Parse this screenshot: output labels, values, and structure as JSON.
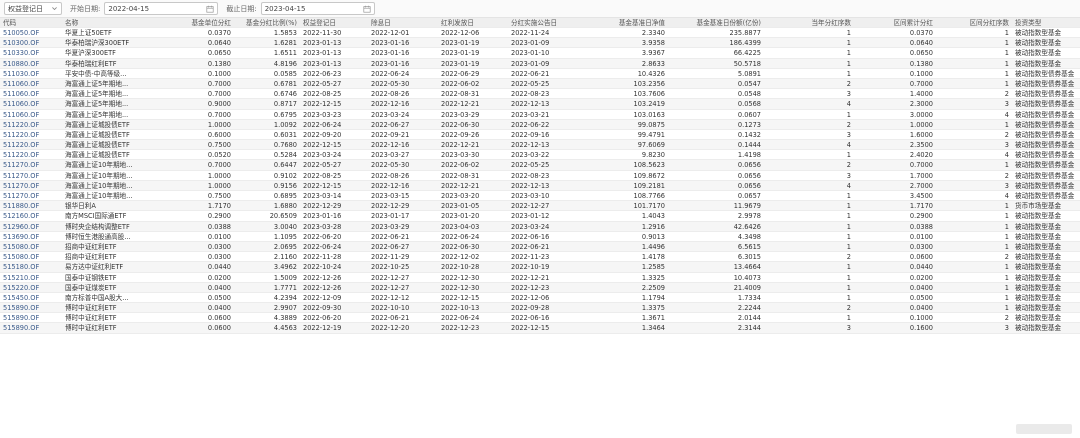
{
  "toolbar": {
    "field_select": "权益登记日",
    "start_label": "开始日期:",
    "start_value": "2022-04-15",
    "end_label": "截止日期:",
    "end_value": "2023-04-15"
  },
  "headers": [
    "代码",
    "名称",
    "基金单位分红",
    "基金分红比例(%)",
    "权益登记日",
    "除息日",
    "红利发放日",
    "分红实施公告日",
    "基金基准日净值",
    "基金基准日份额(亿份)",
    "当年分红序数",
    "区间累计分红",
    "区间分红序数",
    "投资类型"
  ],
  "rows": [
    [
      "510050.OF",
      "华夏上证50ETF",
      "0.0370",
      "1.5853",
      "2022-11-30",
      "2022-12-01",
      "2022-12-06",
      "2022-11-24",
      "2.3340",
      "235.8877",
      "1",
      "0.0370",
      "1",
      "被动指数型基金"
    ],
    [
      "510300.OF",
      "华泰柏瑞沪深300ETF",
      "0.0640",
      "1.6281",
      "2023-01-13",
      "2023-01-16",
      "2023-01-19",
      "2023-01-09",
      "3.9358",
      "186.4399",
      "1",
      "0.0640",
      "1",
      "被动指数型基金"
    ],
    [
      "510330.OF",
      "华夏沪深300ETF",
      "0.0650",
      "1.6511",
      "2023-01-13",
      "2023-01-16",
      "2023-01-19",
      "2023-01-10",
      "3.9367",
      "66.4225",
      "1",
      "0.0650",
      "1",
      "被动指数型基金"
    ],
    [
      "510880.OF",
      "华泰柏瑞红利ETF",
      "0.1380",
      "4.8196",
      "2023-01-13",
      "2023-01-16",
      "2023-01-19",
      "2023-01-09",
      "2.8633",
      "50.5718",
      "1",
      "0.1380",
      "1",
      "被动指数型基金"
    ],
    [
      "511030.OF",
      "平安中债-中高等级...",
      "0.1000",
      "0.0585",
      "2022-06-23",
      "2022-06-24",
      "2022-06-29",
      "2022-06-21",
      "10.4326",
      "5.0891",
      "1",
      "0.1000",
      "1",
      "被动指数型债券基金"
    ],
    [
      "511060.OF",
      "海富通上证5年期地...",
      "0.7000",
      "0.6781",
      "2022-05-27",
      "2022-05-30",
      "2022-06-02",
      "2022-05-25",
      "103.2356",
      "0.0547",
      "2",
      "0.7000",
      "1",
      "被动指数型债券基金"
    ],
    [
      "511060.OF",
      "海富通上证5年期地...",
      "0.7000",
      "0.6746",
      "2022-08-25",
      "2022-08-26",
      "2022-08-31",
      "2022-08-23",
      "103.7606",
      "0.0548",
      "3",
      "1.4000",
      "2",
      "被动指数型债券基金"
    ],
    [
      "511060.OF",
      "海富通上证5年期地...",
      "0.9000",
      "0.8717",
      "2022-12-15",
      "2022-12-16",
      "2022-12-21",
      "2022-12-13",
      "103.2419",
      "0.0568",
      "4",
      "2.3000",
      "3",
      "被动指数型债券基金"
    ],
    [
      "511060.OF",
      "海富通上证5年期地...",
      "0.7000",
      "0.6795",
      "2023-03-23",
      "2023-03-24",
      "2023-03-29",
      "2023-03-21",
      "103.0163",
      "0.0607",
      "1",
      "3.0000",
      "4",
      "被动指数型债券基金"
    ],
    [
      "511220.OF",
      "海富通上证城投债ETF",
      "1.0000",
      "1.0092",
      "2022-06-24",
      "2022-06-27",
      "2022-06-30",
      "2022-06-22",
      "99.0875",
      "0.1273",
      "2",
      "1.0000",
      "1",
      "被动指数型债券基金"
    ],
    [
      "511220.OF",
      "海富通上证城投债ETF",
      "0.6000",
      "0.6031",
      "2022-09-20",
      "2022-09-21",
      "2022-09-26",
      "2022-09-16",
      "99.4791",
      "0.1432",
      "3",
      "1.6000",
      "2",
      "被动指数型债券基金"
    ],
    [
      "511220.OF",
      "海富通上证城投债ETF",
      "0.7500",
      "0.7680",
      "2022-12-15",
      "2022-12-16",
      "2022-12-21",
      "2022-12-13",
      "97.6069",
      "0.1444",
      "4",
      "2.3500",
      "3",
      "被动指数型债券基金"
    ],
    [
      "511220.OF",
      "海富通上证城投债ETF",
      "0.0520",
      "0.5284",
      "2023-03-24",
      "2023-03-27",
      "2023-03-30",
      "2023-03-22",
      "9.8230",
      "1.4198",
      "1",
      "2.4020",
      "4",
      "被动指数型债券基金"
    ],
    [
      "511270.OF",
      "海富通上证10年期地...",
      "0.7000",
      "0.6447",
      "2022-05-27",
      "2022-05-30",
      "2022-06-02",
      "2022-05-25",
      "108.5623",
      "0.0656",
      "2",
      "0.7000",
      "1",
      "被动指数型债券基金"
    ],
    [
      "511270.OF",
      "海富通上证10年期地...",
      "1.0000",
      "0.9102",
      "2022-08-25",
      "2022-08-26",
      "2022-08-31",
      "2022-08-23",
      "109.8672",
      "0.0656",
      "3",
      "1.7000",
      "2",
      "被动指数型债券基金"
    ],
    [
      "511270.OF",
      "海富通上证10年期地...",
      "1.0000",
      "0.9156",
      "2022-12-15",
      "2022-12-16",
      "2022-12-21",
      "2022-12-13",
      "109.2181",
      "0.0656",
      "4",
      "2.7000",
      "3",
      "被动指数型债券基金"
    ],
    [
      "511270.OF",
      "海富通上证10年期地...",
      "0.7500",
      "0.6895",
      "2023-03-14",
      "2023-03-15",
      "2023-03-20",
      "2023-03-10",
      "108.7766",
      "0.0657",
      "1",
      "3.4500",
      "4",
      "被动指数型债券基金"
    ],
    [
      "511880.OF",
      "银华日利A",
      "1.7170",
      "1.6880",
      "2022-12-29",
      "2022-12-29",
      "2023-01-05",
      "2022-12-27",
      "101.7170",
      "11.9679",
      "1",
      "1.7170",
      "1",
      "货币市场型基金"
    ],
    [
      "512160.OF",
      "南方MSCI国际通ETF",
      "0.2900",
      "20.6509",
      "2023-01-16",
      "2023-01-17",
      "2023-01-20",
      "2023-01-12",
      "1.4043",
      "2.9978",
      "1",
      "0.2900",
      "1",
      "被动指数型基金"
    ],
    [
      "512960.OF",
      "博时央企结构调整ETF",
      "0.0388",
      "3.0040",
      "2023-03-28",
      "2023-03-29",
      "2023-04-03",
      "2023-03-24",
      "1.2916",
      "42.6426",
      "1",
      "0.0388",
      "1",
      "被动指数型基金"
    ],
    [
      "513690.OF",
      "博时恒生港股通高股...",
      "0.0100",
      "1.1095",
      "2022-06-20",
      "2022-06-21",
      "2022-06-24",
      "2022-06-16",
      "0.9013",
      "4.3498",
      "1",
      "0.0100",
      "1",
      "被动指数型基金"
    ],
    [
      "515080.OF",
      "招商中证红利ETF",
      "0.0300",
      "2.0695",
      "2022-06-24",
      "2022-06-27",
      "2022-06-30",
      "2022-06-21",
      "1.4496",
      "6.5615",
      "1",
      "0.0300",
      "1",
      "被动指数型基金"
    ],
    [
      "515080.OF",
      "招商中证红利ETF",
      "0.0300",
      "2.1160",
      "2022-11-28",
      "2022-11-29",
      "2022-12-02",
      "2022-11-23",
      "1.4178",
      "6.3015",
      "2",
      "0.0600",
      "2",
      "被动指数型基金"
    ],
    [
      "515180.OF",
      "易方达中证红利ETF",
      "0.0440",
      "3.4962",
      "2022-10-24",
      "2022-10-25",
      "2022-10-28",
      "2022-10-19",
      "1.2585",
      "13.4664",
      "1",
      "0.0440",
      "1",
      "被动指数型基金"
    ],
    [
      "515210.OF",
      "国泰中证钢铁ETF",
      "0.0200",
      "1.5009",
      "2022-12-26",
      "2022-12-27",
      "2022-12-30",
      "2022-12-21",
      "1.3325",
      "10.4073",
      "1",
      "0.0200",
      "1",
      "被动指数型基金"
    ],
    [
      "515220.OF",
      "国泰中证煤炭ETF",
      "0.0400",
      "1.7771",
      "2022-12-26",
      "2022-12-27",
      "2022-12-30",
      "2022-12-23",
      "2.2509",
      "21.4009",
      "1",
      "0.0400",
      "1",
      "被动指数型基金"
    ],
    [
      "515450.OF",
      "南方标普中国A股大...",
      "0.0500",
      "4.2394",
      "2022-12-09",
      "2022-12-12",
      "2022-12-15",
      "2022-12-06",
      "1.1794",
      "1.7334",
      "1",
      "0.0500",
      "1",
      "被动指数型基金"
    ],
    [
      "515890.OF",
      "博时中证红利ETF",
      "0.0400",
      "2.9907",
      "2022-09-30",
      "2022-10-10",
      "2022-10-13",
      "2022-09-28",
      "1.3375",
      "2.2244",
      "2",
      "0.0400",
      "1",
      "被动指数型基金"
    ],
    [
      "515890.OF",
      "博时中证红利ETF",
      "0.0600",
      "4.3889",
      "2022-06-20",
      "2022-06-21",
      "2022-06-24",
      "2022-06-16",
      "1.3671",
      "2.0144",
      "1",
      "0.1000",
      "2",
      "被动指数型基金"
    ],
    [
      "515890.OF",
      "博时中证红利ETF",
      "0.0600",
      "4.4563",
      "2022-12-19",
      "2022-12-20",
      "2022-12-23",
      "2022-12-15",
      "1.3464",
      "2.3144",
      "3",
      "0.1600",
      "3",
      "被动指数型基金"
    ]
  ]
}
